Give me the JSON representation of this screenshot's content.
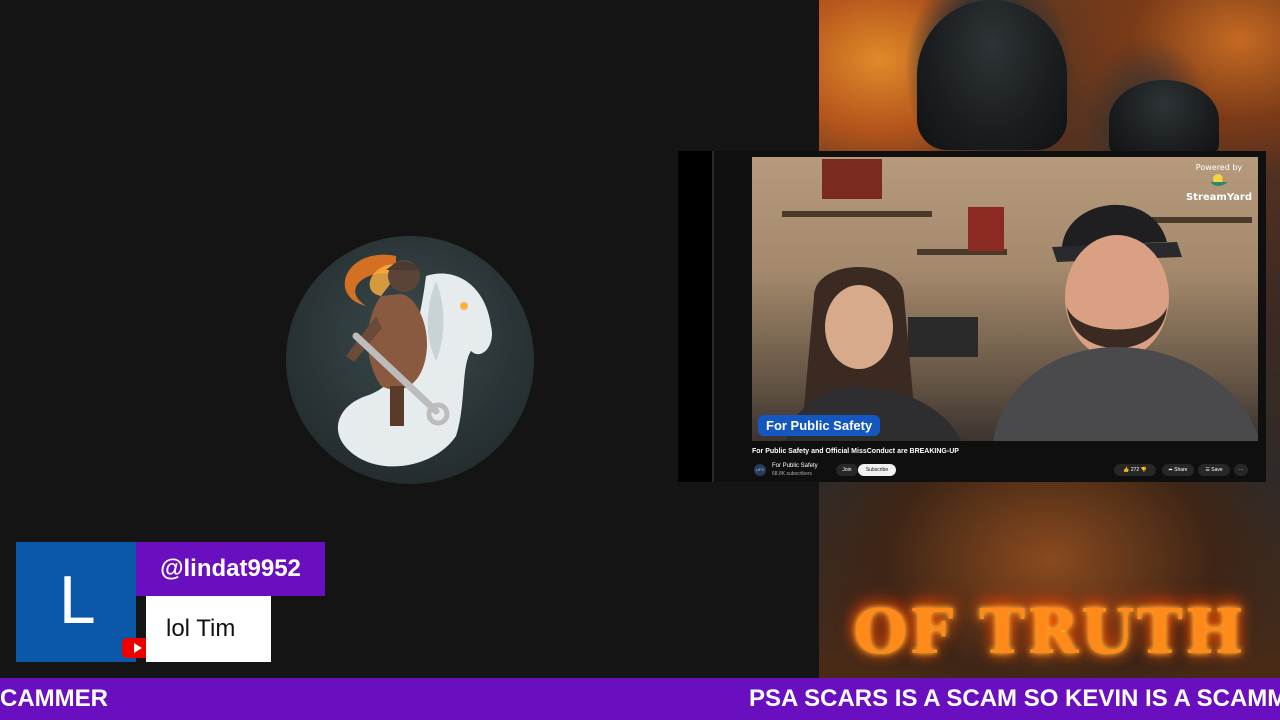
{
  "video": {
    "title": "For Public Safety and Official MissConduct are BREAKING-UP",
    "lower_third": "For Public Safety",
    "channel_name": "For Public Safety",
    "subscribers": "68.8K subscribers",
    "join_label": "Join",
    "subscribe_label": "Subscribe",
    "likes": "272",
    "share_label": "Share",
    "save_label": "Save",
    "more_label": "⋯",
    "powered_by": "Powered by",
    "brand": "StreamYard",
    "channel_logo": "UFS"
  },
  "background": {
    "banner_text": "OF TRUTH"
  },
  "chat": {
    "avatar_letter": "L",
    "username": "@lindat9952",
    "message": "lol Tim"
  },
  "ticker": {
    "left_text": "CAMMER",
    "right_text": "PSA SCARS IS A SCAM SO KEVIN IS A SCAMMER"
  },
  "colors": {
    "ticker_bg": "#6a0fc0",
    "chat_name_bg": "#6a0fc0",
    "avatar_bg": "#0b57a8",
    "lower_third_bg": "#1557c0",
    "youtube_red": "#ee0000"
  }
}
